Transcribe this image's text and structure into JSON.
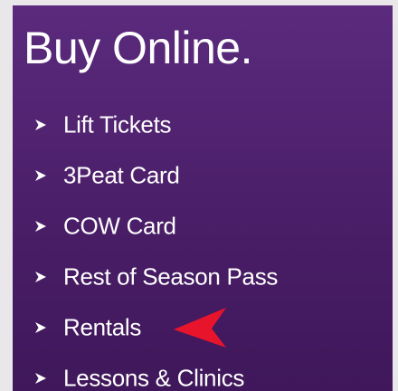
{
  "panel": {
    "title": "Buy Online."
  },
  "menu": {
    "items": [
      {
        "label": "Lift Tickets"
      },
      {
        "label": "3Peat Card"
      },
      {
        "label": "COW Card"
      },
      {
        "label": "Rest of Season Pass"
      },
      {
        "label": "Rentals"
      },
      {
        "label": "Lessons & Clinics"
      }
    ],
    "bullet_icon": "chevron-right-icon",
    "highlight_icon": "red-arrow-pointer-icon"
  },
  "colors": {
    "panel_top": "#5b2a7d",
    "panel_bottom": "#3f175a",
    "text": "#ffffff",
    "arrow": "#e8142c",
    "page_background": "#e9e7ea"
  }
}
